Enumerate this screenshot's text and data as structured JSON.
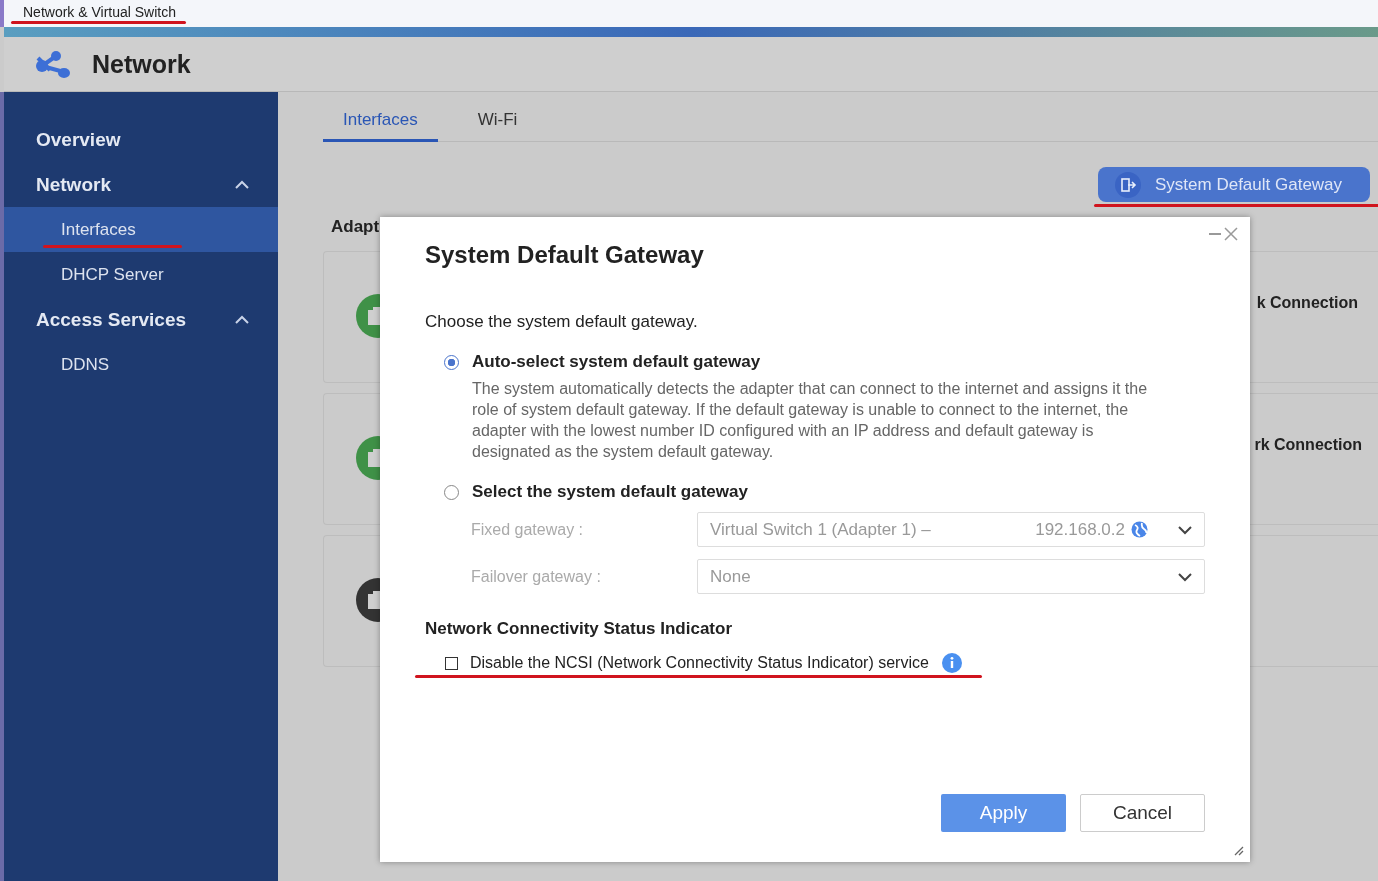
{
  "app_title": {
    "text": "Network & Virtual Switch",
    "underlined": true
  },
  "header": {
    "title": "Network"
  },
  "sidebar": {
    "items": [
      {
        "label": "Overview",
        "kind": "link",
        "selected": false
      },
      {
        "label": "Network",
        "kind": "group",
        "expanded": true,
        "selected": false,
        "children": [
          {
            "label": "Interfaces",
            "selected": true,
            "underlined": true
          },
          {
            "label": "DHCP Server",
            "selected": false,
            "underlined": false
          }
        ]
      },
      {
        "label": "Access Services",
        "kind": "group",
        "expanded": true,
        "selected": false,
        "children": [
          {
            "label": "DDNS",
            "selected": false,
            "underlined": false
          }
        ]
      }
    ]
  },
  "tabs": [
    {
      "label": "Interfaces",
      "selected": true
    },
    {
      "label": "Wi-Fi",
      "selected": false
    }
  ],
  "toolbar_button": {
    "label": "System Default Gateway",
    "underlined": true
  },
  "background": {
    "section_label": "Adapt",
    "cards": [
      {
        "kind": "connected",
        "text": "k Connection"
      },
      {
        "kind": "connected",
        "text": "rk Connection"
      },
      {
        "kind": "unknown"
      }
    ]
  },
  "dialog": {
    "title": "System Default Gateway",
    "prompt": "Choose the system default gateway.",
    "options": [
      {
        "label": "Auto-select system default gateway",
        "selected": true,
        "description": "The system automatically detects the adapter that can connect to the internet and assigns it the role of system default gateway. If the default gateway is unable to connect to the internet, the adapter with the lowest number ID configured with an IP address and default gateway is designated as the system default gateway."
      },
      {
        "label": "Select the system default gateway",
        "selected": false
      }
    ],
    "fields": [
      {
        "label": "Fixed gateway :",
        "value": "Virtual Switch 1 (Adapter 1) –",
        "address": "192.168.0.2",
        "disabled": true
      },
      {
        "label": "Failover gateway :",
        "value": "None",
        "disabled": true
      }
    ],
    "section_title": "Network Connectivity Status Indicator",
    "checkbox": {
      "label": "Disable the NCSI (Network Connectivity Status Indicator) service",
      "checked": false,
      "underlined": true
    },
    "buttons": [
      {
        "label": "Apply",
        "kind": "primary"
      },
      {
        "label": "Cancel",
        "kind": "secondary"
      }
    ]
  }
}
